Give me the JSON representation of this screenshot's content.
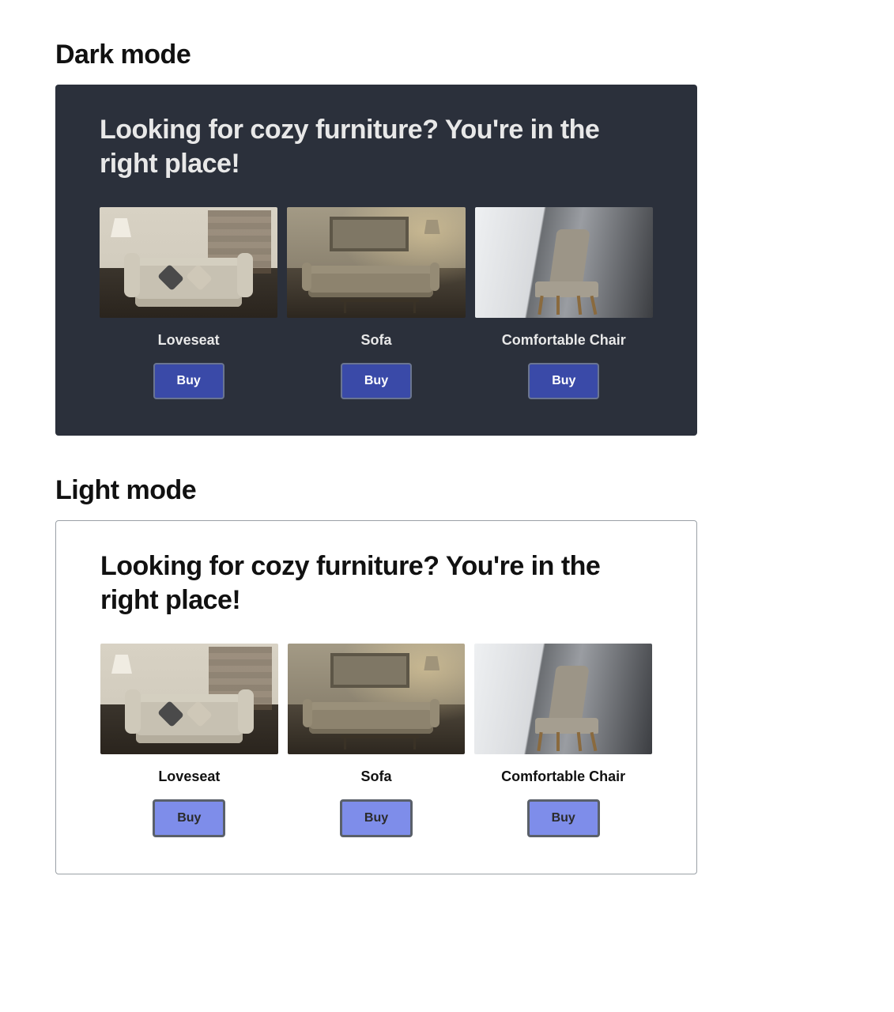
{
  "sections": {
    "dark": {
      "heading": "Dark mode"
    },
    "light": {
      "heading": "Light mode"
    }
  },
  "hero": {
    "title": "Looking for cozy furniture? You're in the right place!"
  },
  "products": [
    {
      "name": "Loveseat",
      "cta": "Buy",
      "image": "loveseat"
    },
    {
      "name": "Sofa",
      "cta": "Buy",
      "image": "sofa"
    },
    {
      "name": "Comfortable Chair",
      "cta": "Buy",
      "image": "chair"
    }
  ],
  "colors": {
    "dark_bg": "#2b303b",
    "dark_button_bg": "#3a4aa8",
    "dark_button_text": "#ffffff",
    "light_bg": "#ffffff",
    "light_border": "#9aa0a6",
    "light_button_bg": "#7e8dea",
    "light_button_border": "#5a606a",
    "light_button_text": "#2b2b2b"
  }
}
